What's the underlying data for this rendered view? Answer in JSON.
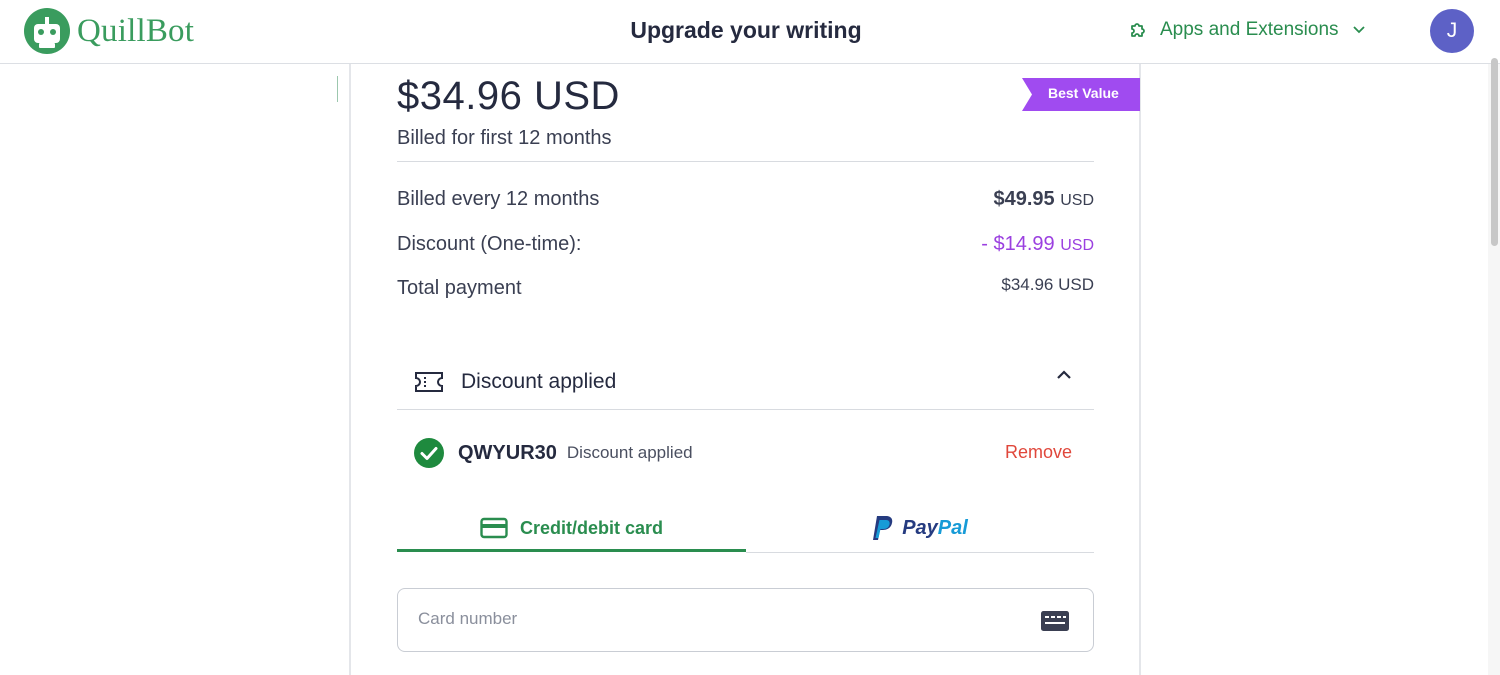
{
  "header": {
    "brand": "QuillBot",
    "title": "Upgrade your writing",
    "apps_label": "Apps and Extensions",
    "avatar_initial": "J"
  },
  "plan": {
    "price": "$34.96 USD",
    "billed_first": "Billed for first 12 months",
    "badge": "Best Value"
  },
  "summary": {
    "rows": [
      {
        "label": "Billed every 12 months",
        "value": "$49.95",
        "currency": "USD"
      },
      {
        "label": "Discount (One-time):",
        "value": "- $14.99",
        "currency": "USD"
      },
      {
        "label": "Total payment",
        "value": "$34.96",
        "currency": "USD"
      }
    ]
  },
  "discount": {
    "section_title": "Discount applied",
    "code": "QWYUR30",
    "status": "Discount applied",
    "remove_label": "Remove"
  },
  "payment": {
    "tabs": [
      {
        "label": "Credit/debit card",
        "selected": true
      },
      {
        "label_a": "Pay",
        "label_b": "Pal",
        "selected": false
      }
    ],
    "card_placeholder": "Card number"
  },
  "colors": {
    "brand_green": "#2a8d4f",
    "discount_purple": "#9b40e0",
    "badge_purple": "#a04bf0",
    "remove_red": "#e0473b",
    "avatar": "#5d61c6",
    "success_green": "#1e8a3e"
  },
  "icons": [
    "quillbot-logo-icon",
    "puzzle-icon",
    "chevron-down-icon",
    "ticket-icon",
    "chevron-up-icon",
    "check-circle-icon",
    "credit-card-icon",
    "paypal-icon",
    "card-number-icon"
  ]
}
